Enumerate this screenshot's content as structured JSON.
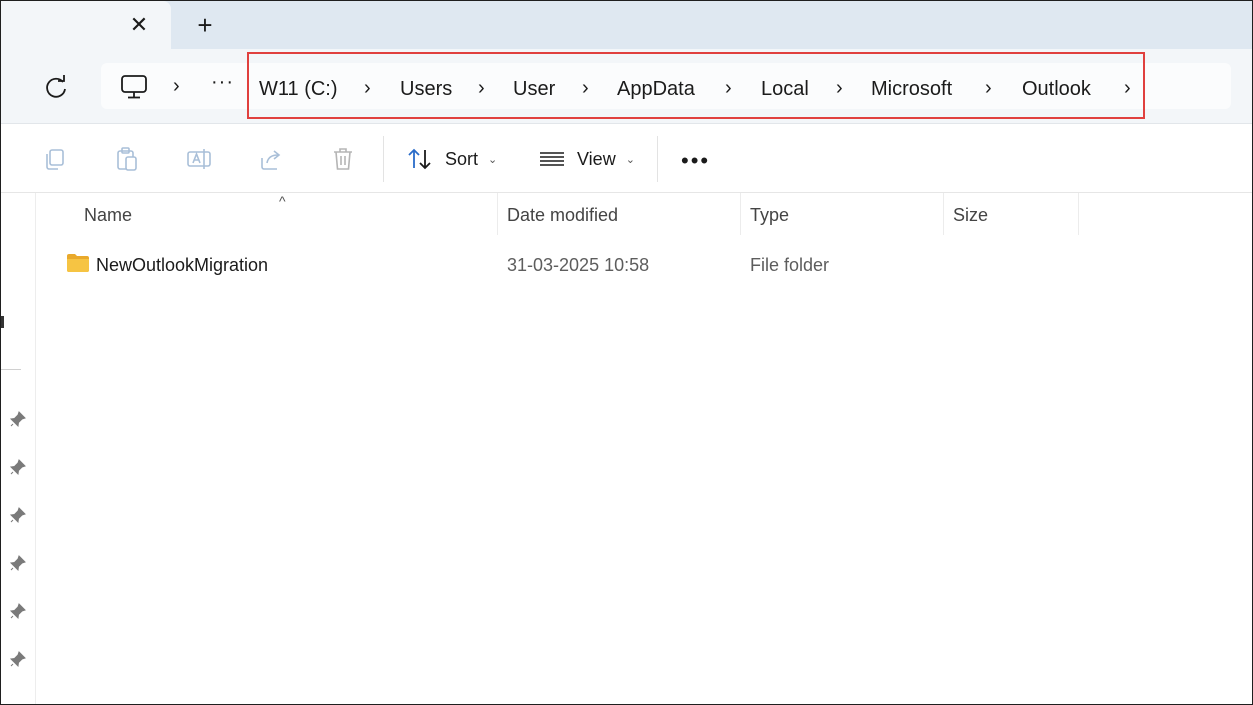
{
  "tabs": {
    "close_glyph": "✕",
    "new_glyph": "+"
  },
  "address": {
    "more_glyph": "···",
    "chevron_glyph": "›",
    "crumbs": [
      "W11 (C:)",
      "Users",
      "User",
      "AppData",
      "Local",
      "Microsoft",
      "Outlook"
    ],
    "highlight_color": "#e0403e"
  },
  "toolbar": {
    "sort_label": "Sort",
    "view_label": "View",
    "dropdown_glyph": "⌄",
    "more_glyph": "•••",
    "icons": [
      "copy-icon",
      "paste-icon",
      "rename-icon",
      "share-icon",
      "delete-icon",
      "sort-icon",
      "view-icon"
    ]
  },
  "list": {
    "columns": [
      "Name",
      "Date modified",
      "Type",
      "Size"
    ],
    "sort_caret": "^",
    "rows": [
      {
        "name": "NewOutlookMigration",
        "date": "31-03-2025 10:58",
        "type": "File folder",
        "size": ""
      }
    ]
  },
  "colors": {
    "tabstrip": "#dfe8f1",
    "accent_blue": "#2a6cc9",
    "folder": "#f6c443"
  }
}
